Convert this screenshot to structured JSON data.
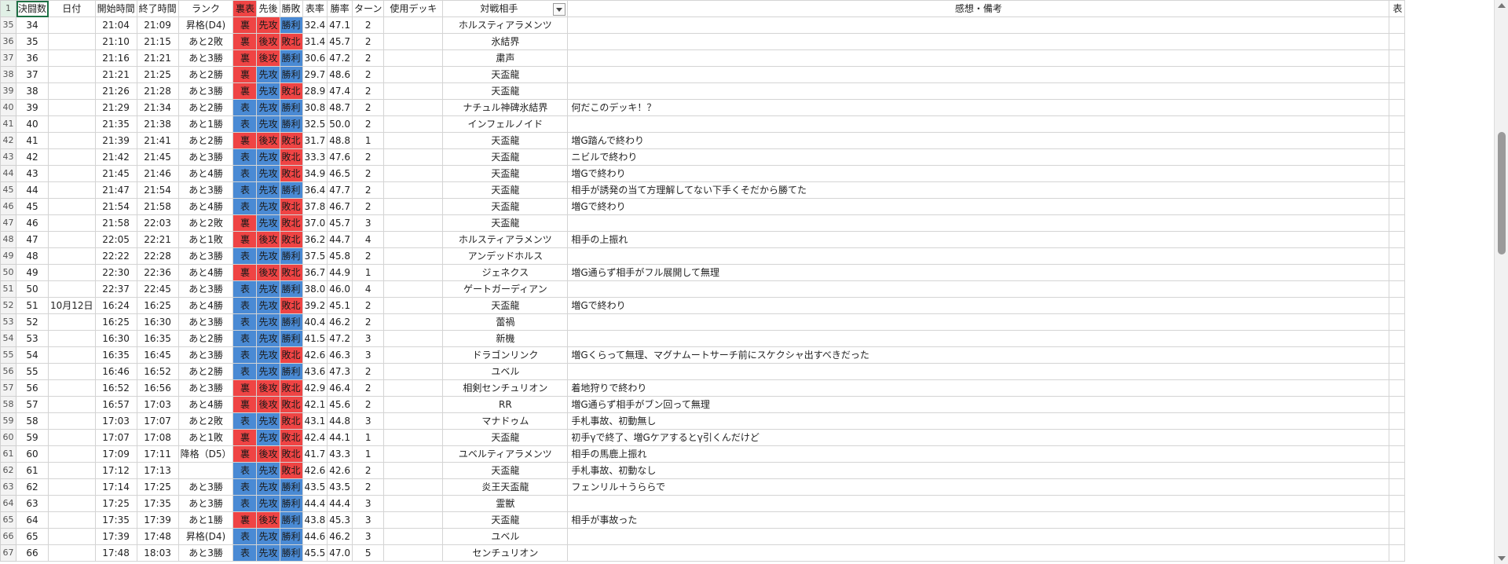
{
  "sheet": {
    "header": {
      "row_number": "1",
      "columns": [
        "決闘数",
        "日付",
        "開始時間",
        "終了時間",
        "ランク",
        "裏表",
        "先後",
        "勝敗",
        "表率",
        "勝率",
        "ターン",
        "使用デッキ",
        "対戦相手",
        "感想・備考",
        "表"
      ]
    },
    "rows": [
      {
        "n": "35",
        "c": [
          "34",
          "",
          "21:04",
          "21:09",
          "昇格(D4)",
          "裏",
          "先攻",
          "勝利",
          "32.4",
          "47.1",
          "2",
          "",
          "ホルスティアラメンツ",
          "",
          ""
        ],
        "k": [
          "r",
          "r",
          "b"
        ]
      },
      {
        "n": "36",
        "c": [
          "35",
          "",
          "21:10",
          "21:15",
          "あと2敗",
          "裏",
          "後攻",
          "敗北",
          "31.4",
          "45.7",
          "2",
          "",
          "氷結界",
          "",
          ""
        ],
        "k": [
          "r",
          "r",
          "r"
        ]
      },
      {
        "n": "37",
        "c": [
          "36",
          "",
          "21:16",
          "21:21",
          "あと3勝",
          "裏",
          "後攻",
          "勝利",
          "30.6",
          "47.2",
          "2",
          "",
          "粛声",
          "",
          ""
        ],
        "k": [
          "r",
          "r",
          "b"
        ]
      },
      {
        "n": "38",
        "c": [
          "37",
          "",
          "21:21",
          "21:25",
          "あと2勝",
          "裏",
          "先攻",
          "勝利",
          "29.7",
          "48.6",
          "2",
          "",
          "天盃龍",
          "",
          ""
        ],
        "k": [
          "r",
          "b",
          "b"
        ]
      },
      {
        "n": "39",
        "c": [
          "38",
          "",
          "21:26",
          "21:28",
          "あと3勝",
          "裏",
          "先攻",
          "敗北",
          "28.9",
          "47.4",
          "2",
          "",
          "天盃龍",
          "",
          ""
        ],
        "k": [
          "r",
          "b",
          "r"
        ]
      },
      {
        "n": "40",
        "c": [
          "39",
          "",
          "21:29",
          "21:34",
          "あと2勝",
          "表",
          "先攻",
          "勝利",
          "30.8",
          "48.7",
          "2",
          "",
          "ナチュル神碑氷結界",
          "何だこのデッキ！？",
          ""
        ],
        "k": [
          "b",
          "b",
          "b"
        ]
      },
      {
        "n": "41",
        "c": [
          "40",
          "",
          "21:35",
          "21:38",
          "あと1勝",
          "表",
          "先攻",
          "勝利",
          "32.5",
          "50.0",
          "2",
          "",
          "インフェルノイド",
          "",
          ""
        ],
        "k": [
          "b",
          "b",
          "b"
        ]
      },
      {
        "n": "42",
        "c": [
          "41",
          "",
          "21:39",
          "21:41",
          "あと2勝",
          "裏",
          "後攻",
          "敗北",
          "31.7",
          "48.8",
          "1",
          "",
          "天盃龍",
          "増G踏んで終わり",
          ""
        ],
        "k": [
          "r",
          "r",
          "r"
        ]
      },
      {
        "n": "43",
        "c": [
          "42",
          "",
          "21:42",
          "21:45",
          "あと3勝",
          "表",
          "先攻",
          "敗北",
          "33.3",
          "47.6",
          "2",
          "",
          "天盃龍",
          "ニビルで終わり",
          ""
        ],
        "k": [
          "b",
          "b",
          "r"
        ]
      },
      {
        "n": "44",
        "c": [
          "43",
          "",
          "21:45",
          "21:46",
          "あと4勝",
          "表",
          "先攻",
          "敗北",
          "34.9",
          "46.5",
          "2",
          "",
          "天盃龍",
          "増Gで終わり",
          ""
        ],
        "k": [
          "b",
          "b",
          "r"
        ]
      },
      {
        "n": "45",
        "c": [
          "44",
          "",
          "21:47",
          "21:54",
          "あと3勝",
          "表",
          "先攻",
          "勝利",
          "36.4",
          "47.7",
          "2",
          "",
          "天盃龍",
          "相手が誘発の当て方理解してない下手くそだから勝てた",
          ""
        ],
        "k": [
          "b",
          "b",
          "b"
        ]
      },
      {
        "n": "46",
        "c": [
          "45",
          "",
          "21:54",
          "21:58",
          "あと4勝",
          "表",
          "先攻",
          "敗北",
          "37.8",
          "46.7",
          "2",
          "",
          "天盃龍",
          "増Gで終わり",
          ""
        ],
        "k": [
          "b",
          "b",
          "r"
        ]
      },
      {
        "n": "47",
        "c": [
          "46",
          "",
          "21:58",
          "22:03",
          "あと2敗",
          "裏",
          "先攻",
          "敗北",
          "37.0",
          "45.7",
          "3",
          "",
          "天盃龍",
          "",
          ""
        ],
        "k": [
          "r",
          "b",
          "r"
        ]
      },
      {
        "n": "48",
        "c": [
          "47",
          "",
          "22:05",
          "22:21",
          "あと1敗",
          "裏",
          "後攻",
          "敗北",
          "36.2",
          "44.7",
          "4",
          "",
          "ホルスティアラメンツ",
          "相手の上振れ",
          ""
        ],
        "k": [
          "r",
          "r",
          "r"
        ]
      },
      {
        "n": "49",
        "c": [
          "48",
          "",
          "22:22",
          "22:28",
          "あと3勝",
          "表",
          "先攻",
          "勝利",
          "37.5",
          "45.8",
          "2",
          "",
          "アンデッドホルス",
          "",
          ""
        ],
        "k": [
          "b",
          "b",
          "b"
        ]
      },
      {
        "n": "50",
        "c": [
          "49",
          "",
          "22:30",
          "22:36",
          "あと4勝",
          "裏",
          "後攻",
          "敗北",
          "36.7",
          "44.9",
          "1",
          "",
          "ジェネクス",
          "増G通らず相手がフル展開して無理",
          ""
        ],
        "k": [
          "r",
          "r",
          "r"
        ]
      },
      {
        "n": "51",
        "c": [
          "50",
          "",
          "22:37",
          "22:45",
          "あと3勝",
          "表",
          "先攻",
          "勝利",
          "38.0",
          "46.0",
          "4",
          "",
          "ゲートガーディアン",
          "",
          ""
        ],
        "k": [
          "b",
          "b",
          "b"
        ]
      },
      {
        "n": "52",
        "c": [
          "51",
          "10月12日",
          "16:24",
          "16:25",
          "あと4勝",
          "表",
          "先攻",
          "敗北",
          "39.2",
          "45.1",
          "2",
          "",
          "天盃龍",
          "増Gで終わり",
          ""
        ],
        "k": [
          "b",
          "b",
          "r"
        ]
      },
      {
        "n": "53",
        "c": [
          "52",
          "",
          "16:25",
          "16:30",
          "あと3勝",
          "表",
          "先攻",
          "勝利",
          "40.4",
          "46.2",
          "2",
          "",
          "蕾禍",
          "",
          ""
        ],
        "k": [
          "b",
          "b",
          "b"
        ]
      },
      {
        "n": "54",
        "c": [
          "53",
          "",
          "16:30",
          "16:35",
          "あと2勝",
          "表",
          "先攻",
          "勝利",
          "41.5",
          "47.2",
          "3",
          "",
          "新機",
          "",
          ""
        ],
        "k": [
          "b",
          "b",
          "b"
        ]
      },
      {
        "n": "55",
        "c": [
          "54",
          "",
          "16:35",
          "16:45",
          "あと3勝",
          "表",
          "先攻",
          "敗北",
          "42.6",
          "46.3",
          "3",
          "",
          "ドラゴンリンク",
          "増Gくらって無理、マグナムートサーチ前にスケクシャ出すべきだった",
          ""
        ],
        "k": [
          "b",
          "b",
          "r"
        ]
      },
      {
        "n": "56",
        "c": [
          "55",
          "",
          "16:46",
          "16:52",
          "あと2勝",
          "表",
          "先攻",
          "勝利",
          "43.6",
          "47.3",
          "2",
          "",
          "ユベル",
          "",
          ""
        ],
        "k": [
          "b",
          "b",
          "b"
        ]
      },
      {
        "n": "57",
        "c": [
          "56",
          "",
          "16:52",
          "16:56",
          "あと3勝",
          "裏",
          "後攻",
          "敗北",
          "42.9",
          "46.4",
          "2",
          "",
          "相剣センチュリオン",
          "着地狩りで終わり",
          ""
        ],
        "k": [
          "r",
          "r",
          "r"
        ]
      },
      {
        "n": "58",
        "c": [
          "57",
          "",
          "16:57",
          "17:03",
          "あと4勝",
          "裏",
          "後攻",
          "敗北",
          "42.1",
          "45.6",
          "2",
          "",
          "RR",
          "増G通らず相手がブン回って無理",
          ""
        ],
        "k": [
          "r",
          "r",
          "r"
        ]
      },
      {
        "n": "59",
        "c": [
          "58",
          "",
          "17:03",
          "17:07",
          "あと2敗",
          "表",
          "先攻",
          "敗北",
          "43.1",
          "44.8",
          "3",
          "",
          "マナドゥム",
          "手札事故、初動無し",
          ""
        ],
        "k": [
          "b",
          "b",
          "r"
        ]
      },
      {
        "n": "60",
        "c": [
          "59",
          "",
          "17:07",
          "17:08",
          "あと1敗",
          "裏",
          "先攻",
          "敗北",
          "42.4",
          "44.1",
          "1",
          "",
          "天盃龍",
          "初手γで終了、増Gケアするとγ引くんだけど",
          ""
        ],
        "k": [
          "r",
          "b",
          "r"
        ]
      },
      {
        "n": "61",
        "c": [
          "60",
          "",
          "17:09",
          "17:11",
          "降格（D5）",
          "裏",
          "後攻",
          "敗北",
          "41.7",
          "43.3",
          "1",
          "",
          "ユベルティアラメンツ",
          "相手の馬鹿上振れ",
          ""
        ],
        "k": [
          "r",
          "r",
          "r"
        ]
      },
      {
        "n": "62",
        "c": [
          "61",
          "",
          "17:12",
          "17:13",
          "",
          "表",
          "先攻",
          "敗北",
          "42.6",
          "42.6",
          "2",
          "",
          "天盃龍",
          "手札事故、初動なし",
          ""
        ],
        "k": [
          "b",
          "b",
          "r"
        ]
      },
      {
        "n": "63",
        "c": [
          "62",
          "",
          "17:14",
          "17:25",
          "あと3勝",
          "表",
          "先攻",
          "勝利",
          "43.5",
          "43.5",
          "2",
          "",
          "炎王天盃龍",
          "フェンリル＋うららで",
          ""
        ],
        "k": [
          "b",
          "b",
          "b"
        ]
      },
      {
        "n": "64",
        "c": [
          "63",
          "",
          "17:25",
          "17:35",
          "あと3勝",
          "表",
          "先攻",
          "勝利",
          "44.4",
          "44.4",
          "3",
          "",
          "霊獣",
          "",
          ""
        ],
        "k": [
          "b",
          "b",
          "b"
        ]
      },
      {
        "n": "65",
        "c": [
          "64",
          "",
          "17:35",
          "17:39",
          "あと1勝",
          "裏",
          "後攻",
          "勝利",
          "43.8",
          "45.3",
          "3",
          "",
          "天盃龍",
          "相手が事故った",
          ""
        ],
        "k": [
          "r",
          "r",
          "b"
        ]
      },
      {
        "n": "66",
        "c": [
          "65",
          "",
          "17:39",
          "17:48",
          "昇格(D4)",
          "表",
          "先攻",
          "勝利",
          "44.6",
          "46.2",
          "3",
          "",
          "ユベル",
          "",
          ""
        ],
        "k": [
          "b",
          "b",
          "b"
        ]
      },
      {
        "n": "67",
        "c": [
          "66",
          "",
          "17:48",
          "18:03",
          "あと3勝",
          "表",
          "先攻",
          "勝利",
          "45.5",
          "47.0",
          "5",
          "",
          "センチュリオン",
          "",
          ""
        ],
        "k": [
          "b",
          "b",
          "b"
        ]
      }
    ]
  },
  "colors": {
    "red": "#ef4444",
    "blue": "#4a8ad4",
    "selection": "#1e7145"
  }
}
